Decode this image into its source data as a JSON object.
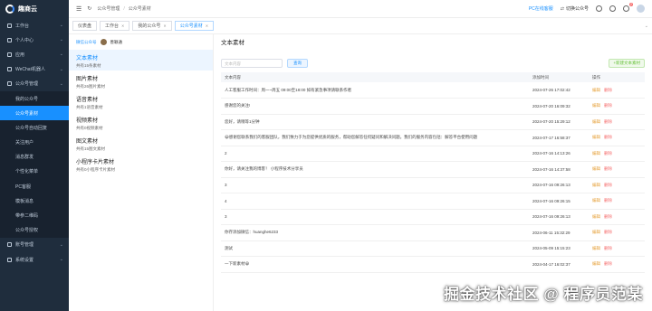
{
  "app": {
    "name": "趣商云"
  },
  "sidebar": {
    "items": [
      {
        "label": "工作台",
        "type": "group"
      },
      {
        "label": "个人中心",
        "type": "group"
      },
      {
        "label": "应用",
        "type": "group"
      },
      {
        "label": "WeChat机器人",
        "type": "group"
      },
      {
        "label": "公众号管理",
        "type": "group"
      },
      {
        "label": "我的公众号",
        "type": "sub"
      },
      {
        "label": "公众号素材",
        "type": "sub-active"
      },
      {
        "label": "公众号自动回复",
        "type": "sub"
      },
      {
        "label": "关注用户",
        "type": "sub"
      },
      {
        "label": "消息群发",
        "type": "sub"
      },
      {
        "label": "个性化菜单",
        "type": "sub"
      },
      {
        "label": "PC客服",
        "type": "sub"
      },
      {
        "label": "模板消息",
        "type": "sub"
      },
      {
        "label": "带参二维码",
        "type": "sub"
      },
      {
        "label": "公众号授权",
        "type": "sub"
      },
      {
        "label": "账号管理",
        "type": "group"
      },
      {
        "label": "系统设置",
        "type": "group"
      }
    ]
  },
  "topbar": {
    "breadcrumb": [
      "公众号管理",
      "公众号素材"
    ],
    "pc_link": "PC在线客服",
    "account_switch": "切换公众号",
    "notify_count": "2"
  },
  "tabs": [
    {
      "label": "仪表盘",
      "active": false
    },
    {
      "label": "工作台",
      "active": false
    },
    {
      "label": "我的公众号",
      "active": false
    },
    {
      "label": "公众号素材",
      "active": true
    }
  ],
  "account": {
    "switch_label": "微信公众号",
    "name": "善颖通"
  },
  "categories": [
    {
      "name": "文本素材",
      "count": "共有15条素材",
      "active": true
    },
    {
      "name": "图片素材",
      "count": "共有26图片素材",
      "active": false
    },
    {
      "name": "语音素材",
      "count": "共有1语音素材",
      "active": false
    },
    {
      "name": "视频素材",
      "count": "共有0视频素材",
      "active": false
    },
    {
      "name": "图文素材",
      "count": "共有15图文素材",
      "active": false
    },
    {
      "name": "小程序卡片素材",
      "count": "共有0小程序卡片素材",
      "active": false
    }
  ],
  "main": {
    "title": "文本素材",
    "search_placeholder": "文本内容",
    "query_label": "查询",
    "add_label": "+新建文本素材",
    "columns": [
      "文本内容",
      "添加时间",
      "操作"
    ],
    "edit_label": "编辑",
    "delete_label": "删除",
    "rows": [
      {
        "content": "人工客服工作时间：周一~周五 09:00至18:00 如有紧急事项请联系作者",
        "time": "2024-07-26 17:02:42"
      },
      {
        "content": "感谢您的关注!",
        "time": "2024-07-20 16:09:32"
      },
      {
        "content": "您好，请稍等1分钟",
        "time": "2024-07-20 15:29:12"
      },
      {
        "content": "😀感谢您联系我们的客服团队，我们致力于为您提供优质的服务，帮助您解答任何疑问和解决问题。我们的服务内容包括：解答平台使用问题",
        "time": "2024-07-17 16:58:37"
      },
      {
        "content": "2",
        "time": "2024-07-16 14:13:26"
      },
      {
        "content": "你好，请关注我的博客！ 小程序技术分享员",
        "time": "2024-07-16 14:37:58"
      },
      {
        "content": "3",
        "time": "2024-07-16 09:26:13"
      },
      {
        "content": "4",
        "time": "2024-07-16 09:26:15"
      },
      {
        "content": "3",
        "time": "2024-07-16 09:26:13"
      },
      {
        "content": "你存添加微信：huanghe6233",
        "time": "2024-06-11 15:32:29"
      },
      {
        "content": "测试",
        "time": "2024-05-09 15:15:23"
      },
      {
        "content": "一下新素材😀",
        "time": "2024-04-17 16:02:37"
      }
    ]
  },
  "watermark": "掘金技术社区 @ 程序员范某"
}
